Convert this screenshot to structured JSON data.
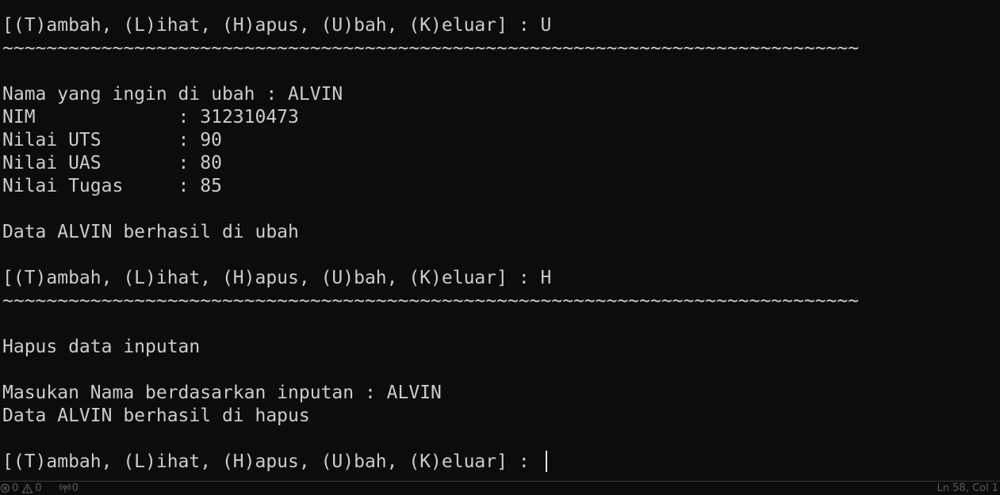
{
  "terminal": {
    "lines": [
      "[(T)ambah, (L)ihat, (H)apus, (U)bah, (K)eluar] : U",
      "~~~~~~~~~~~~~~~~~~~~~~~~~~~~~~~~~~~~~~~~~~~~~~~~~~~~~~~~~~~~~~~~~~~~~~~~~~~~~~",
      "",
      "Nama yang ingin di ubah : ALVIN",
      "NIM             : 312310473",
      "Nilai UTS       : 90",
      "Nilai UAS       : 80",
      "Nilai Tugas     : 85",
      "",
      "Data ALVIN berhasil di ubah",
      "",
      "[(T)ambah, (L)ihat, (H)apus, (U)bah, (K)eluar] : H",
      "~~~~~~~~~~~~~~~~~~~~~~~~~~~~~~~~~~~~~~~~~~~~~~~~~~~~~~~~~~~~~~~~~~~~~~~~~~~~~~",
      "",
      "Hapus data inputan",
      "",
      "Masukan Nama berdasarkan inputan : ALVIN",
      "Data ALVIN berhasil di hapus",
      "",
      "[(T)ambah, (L)ihat, (H)apus, (U)bah, (K)eluar] : "
    ]
  },
  "statusbar": {
    "errors": "0",
    "warnings": "0",
    "ports": "0",
    "position": "Ln 58, Col 1"
  },
  "colors": {
    "background": "#0c0c0c",
    "foreground": "#cccccc",
    "status_text": "#5a5a5a"
  },
  "icons": [
    "error-icon",
    "warning-icon",
    "ports-icon"
  ]
}
